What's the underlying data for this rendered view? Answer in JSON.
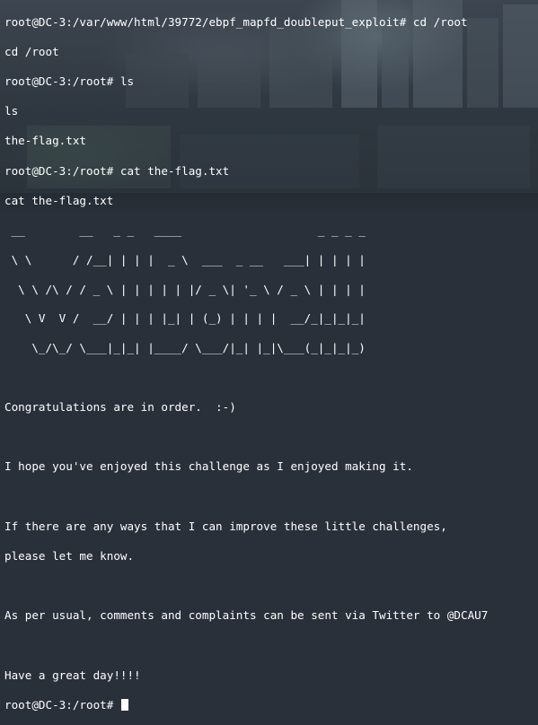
{
  "terminal": {
    "commands": [
      "root@DC-3:/var/www/html/39772/ebpf_mapfd_doubleput_exploit# cd /root",
      "cd /root",
      "root@DC-3:/root# ls",
      "ls",
      "the-flag.txt",
      "root@DC-3:/root# cat the-flag.txt",
      "cat the-flag.txt"
    ],
    "banner": [
      " __        __   _ _   ____                    _ _ _ _ ",
      " \\ \\      / /__| | | |  _ \\  ___  _ __   ___| | | | |",
      "  \\ \\ /\\ / / _ \\ | | | | | |/ _ \\| '_ \\ / _ \\ | | | |",
      "   \\ V  V /  __/ | | | |_| | (_) | | | |  __/_|_|_|_|",
      "    \\_/\\_/ \\___|_|_| |____/ \\___/|_| |_|\\___(_|_|_|_)"
    ],
    "message": {
      "congrats": "Congratulations are in order.  :-)",
      "enjoyed": "I hope you've enjoyed this challenge as I enjoyed making it.",
      "improve_1": "If there are any ways that I can improve these little challenges,",
      "improve_2": "please let me know.",
      "contact": "As per usual, comments and complaints can be sent via Twitter to @DCAU7",
      "farewell": "Have a great day!!!!"
    },
    "prompt": "root@DC-3:/root# "
  },
  "colors": {
    "text": "#ffffff",
    "background": "#2a3039"
  }
}
